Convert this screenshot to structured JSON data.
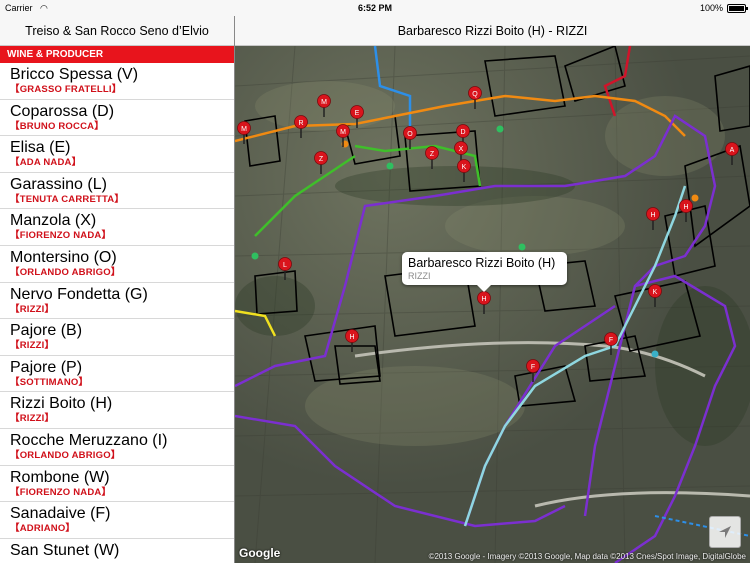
{
  "status_bar": {
    "carrier": "Carrier",
    "time": "6:52 PM",
    "battery": "100%"
  },
  "left_panel": {
    "title": "Treiso & San Rocco Seno d’Elvio",
    "section_header": "WINE & PRODUCER",
    "items": [
      {
        "name": "Bricco Spessa (V)",
        "producer": "【GRASSO FRATELLI】"
      },
      {
        "name": "Coparossa (D)",
        "producer": "【BRUNO ROCCA】"
      },
      {
        "name": "Elisa (E)",
        "producer": "【ADA NADA】"
      },
      {
        "name": "Garassino (L)",
        "producer": "【TENUTA CARRETTA】"
      },
      {
        "name": "Manzola (X)",
        "producer": "【FIORENZO NADA】"
      },
      {
        "name": "Montersino (O)",
        "producer": "【ORLANDO ABRIGO】"
      },
      {
        "name": "Nervo Fondetta (G)",
        "producer": "【RIZZI】"
      },
      {
        "name": "Pajore (B)",
        "producer": "【RIZZI】"
      },
      {
        "name": "Pajore (P)",
        "producer": "【SOTTIMANO】"
      },
      {
        "name": "Rizzi Boito (H)",
        "producer": "【RIZZI】"
      },
      {
        "name": "Rocche Meruzzano (I)",
        "producer": "【ORLANDO ABRIGO】"
      },
      {
        "name": "Rombone (W)",
        "producer": "【FIORENZO NADA】"
      },
      {
        "name": "Sanadaive (F)",
        "producer": "【ADRIANO】"
      },
      {
        "name": "San Stunet (W)",
        "producer": ""
      }
    ]
  },
  "right_panel": {
    "title": "Barbaresco Rizzi Boito (H) - RIZZI",
    "callout": {
      "title": "Barbaresco Rizzi Boito (H)",
      "subtitle": "RIZZI"
    },
    "google_logo": "Google",
    "copyright": "©2013 Google - Imagery ©2013 Google, Map data ©2013 Cnes/Spot Image, DigitalGlobe",
    "pins": [
      {
        "label": "M"
      },
      {
        "label": "R"
      },
      {
        "label": "M"
      },
      {
        "label": "E"
      },
      {
        "label": "M"
      },
      {
        "label": "Z"
      },
      {
        "label": "O"
      },
      {
        "label": "Q"
      },
      {
        "label": "D"
      },
      {
        "label": "X"
      },
      {
        "label": "Z"
      },
      {
        "label": "K"
      },
      {
        "label": "A"
      },
      {
        "label": "H"
      },
      {
        "label": "H"
      },
      {
        "label": "L"
      },
      {
        "label": "H"
      },
      {
        "label": "K"
      },
      {
        "label": "H"
      },
      {
        "label": "F"
      },
      {
        "label": "F"
      }
    ],
    "colors": {
      "pin": "#d9141c",
      "route_purple": "#7b2fd0",
      "route_orange": "#f08a12",
      "route_green": "#3fbf2a",
      "route_cyan": "#8fd7e0",
      "route_blue": "#2d8fe8",
      "route_red": "#d0142a",
      "route_yellow": "#f0e020"
    }
  }
}
